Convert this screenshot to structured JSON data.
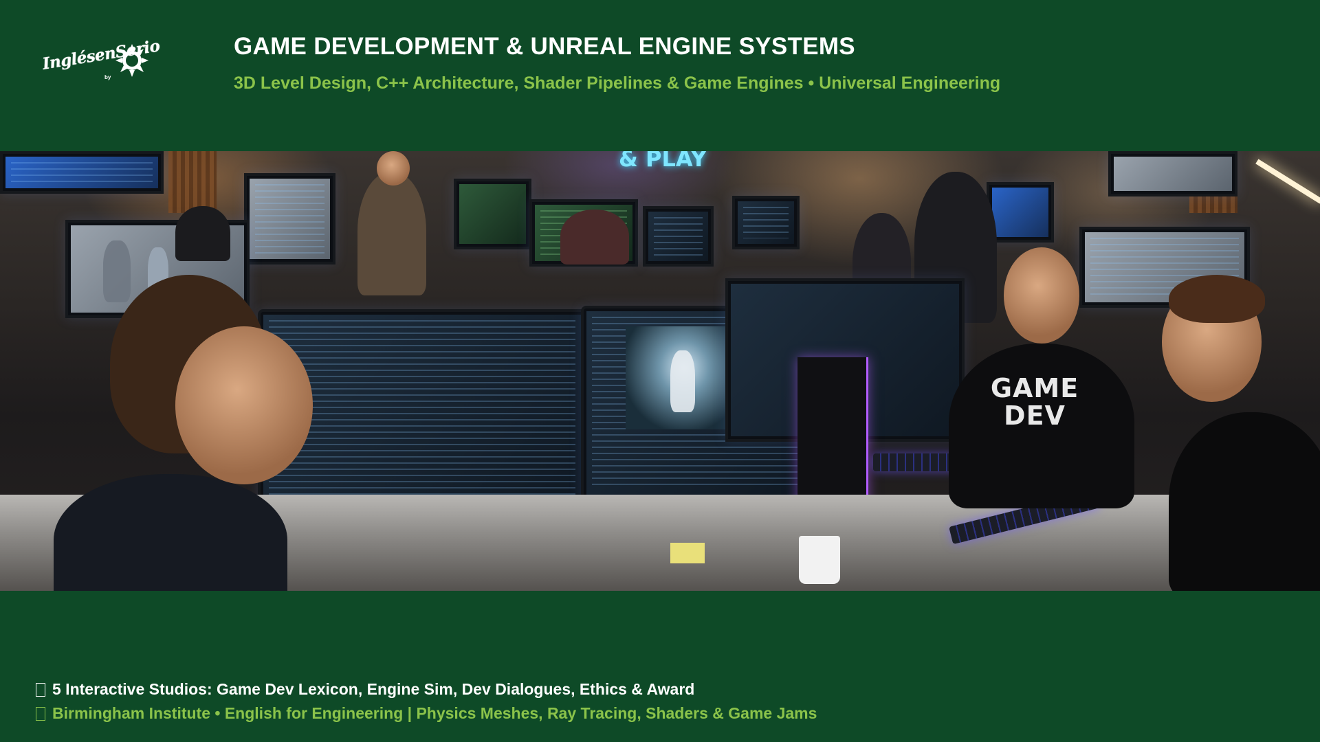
{
  "header": {
    "logo": {
      "text": "InglésenSerio",
      "sub": "by",
      "icon": "sun-burst-icon"
    },
    "title": "GAME DEVELOPMENT & UNREAL ENGINE SYSTEMS",
    "subtitle": "3D Level Design, C++ Architecture, Shader Pipelines & Game Engines • Universal Engineering"
  },
  "photo": {
    "shirt_text_line1": "GAME",
    "shirt_text_line2": "DEV",
    "neon_sign": "& PLAY"
  },
  "footer": {
    "line1": {
      "icon": "missing-glyph-icon",
      "text": "5 Interactive Studios: Game Dev Lexicon, Engine Sim, Dev Dialogues, Ethics & Award"
    },
    "line2": {
      "icon": "missing-glyph-icon",
      "text": "Birmingham Institute • English for Engineering | Physics Meshes, Ray Tracing, Shaders & Game Jams"
    }
  },
  "colors": {
    "background": "#0e4a27",
    "title": "#ffffff",
    "accent": "#8bc34a"
  }
}
